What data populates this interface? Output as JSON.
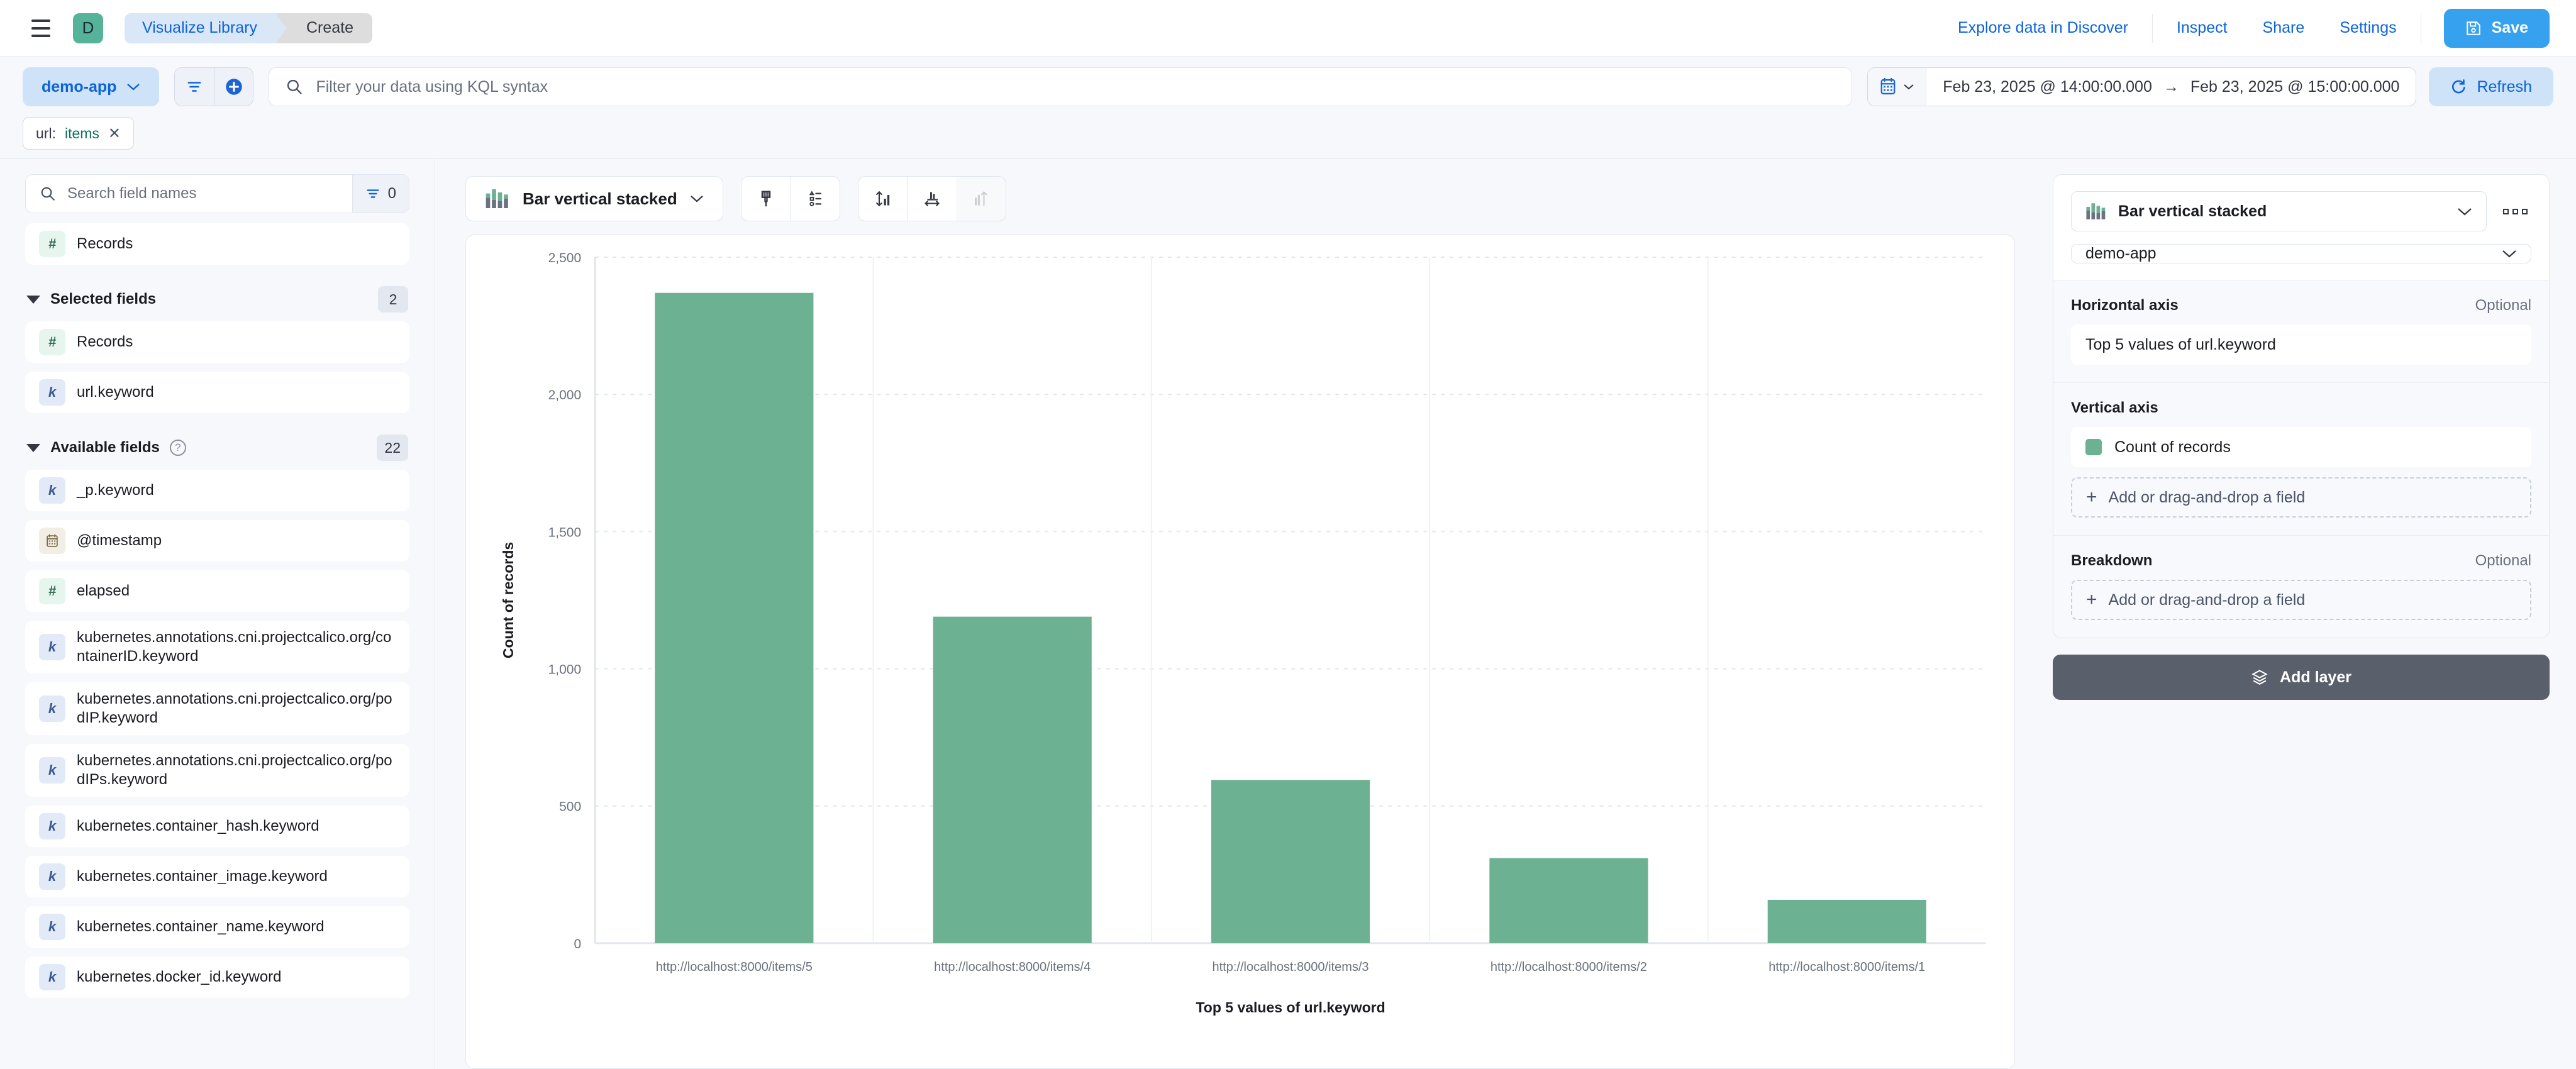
{
  "topnav": {
    "menu_icon": "hamburger-icon",
    "space_initial": "D",
    "breadcrumbs": [
      {
        "label": "Visualize Library"
      },
      {
        "label": "Create"
      }
    ],
    "links": [
      {
        "label": "Explore data in Discover"
      },
      {
        "label": "Inspect"
      },
      {
        "label": "Share"
      },
      {
        "label": "Settings"
      }
    ],
    "save_label": "Save",
    "save_icon": "save-disk-icon",
    "accent_blue": "#36A2EF"
  },
  "querybar": {
    "dataview": "demo-app",
    "filter_icon": "filter-lines-icon",
    "add_filter_icon": "plus-circle-icon",
    "search_icon": "search-icon",
    "kql_placeholder": "Filter your data using KQL syntax",
    "kql_value": "",
    "calendar_icon": "calendar-icon",
    "date_start": "Feb 23, 2025 @ 14:00:00.000",
    "date_arrow": "→",
    "date_end": "Feb 23, 2025 @ 15:00:00.000",
    "refresh_label": "Refresh",
    "refresh_icon": "refresh-icon"
  },
  "filters": [
    {
      "key": "url:",
      "value": "items",
      "remove_icon": "close-icon"
    }
  ],
  "sidebar": {
    "search_placeholder": "Search field names",
    "search_value": "",
    "field_filter_count": "0",
    "records_field": {
      "label": "Records",
      "type": "number",
      "badge": "#"
    },
    "selected_section": {
      "title": "Selected fields",
      "count": "2"
    },
    "selected_fields": [
      {
        "label": "Records",
        "type": "number",
        "badge": "#"
      },
      {
        "label": "url.keyword",
        "type": "string",
        "badge": "k"
      }
    ],
    "available_section": {
      "title": "Available fields",
      "count": "22",
      "help_icon": "question-icon"
    },
    "available_fields": [
      {
        "label": "_p.keyword",
        "type": "string",
        "badge": "k"
      },
      {
        "label": "@timestamp",
        "type": "date",
        "badge": "🗓"
      },
      {
        "label": "elapsed",
        "type": "number",
        "badge": "#"
      },
      {
        "label": "kubernetes.annotations.cni.projectcalico.org/containerID.keyword",
        "type": "string",
        "badge": "k"
      },
      {
        "label": "kubernetes.annotations.cni.projectcalico.org/podIP.keyword",
        "type": "string",
        "badge": "k"
      },
      {
        "label": "kubernetes.annotations.cni.projectcalico.org/podIPs.keyword",
        "type": "string",
        "badge": "k"
      },
      {
        "label": "kubernetes.container_hash.keyword",
        "type": "string",
        "badge": "k"
      },
      {
        "label": "kubernetes.container_image.keyword",
        "type": "string",
        "badge": "k"
      },
      {
        "label": "kubernetes.container_name.keyword",
        "type": "string",
        "badge": "k"
      },
      {
        "label": "kubernetes.docker_id.keyword",
        "type": "string",
        "badge": "k"
      }
    ]
  },
  "chart_toolbar": {
    "chart_type": "Bar vertical stacked",
    "chart_type_icon": "bar-chart-icon",
    "appearance_icon": "brush-icon",
    "legend_icon": "legend-list-icon",
    "vertical_axis_icon": "vertical-axis-icon",
    "horizontal_axis_icon": "horizontal-axis-icon",
    "secondary_axis_icon": "secondary-axis-icon"
  },
  "config": {
    "chart_type": "Bar vertical stacked",
    "chart_type_icon": "bar-chart-icon",
    "dataview": "demo-app",
    "more_icon": "more-options-icon",
    "horizontal": {
      "title": "Horizontal axis",
      "optional": "Optional",
      "dimension": "Top 5 values of url.keyword"
    },
    "vertical": {
      "title": "Vertical axis",
      "optional": "",
      "dimension": "Count of records",
      "swatch_color": "#6DB193",
      "add_field": "Add or drag-and-drop a field"
    },
    "breakdown": {
      "title": "Breakdown",
      "optional": "Optional",
      "add_field": "Add or drag-and-drop a field"
    },
    "add_layer": "Add layer",
    "add_layer_icon": "layers-icon"
  },
  "chart_data": {
    "type": "bar",
    "title": "",
    "xlabel": "Top 5 values of url.keyword",
    "ylabel": "Count of records",
    "categories": [
      "http://localhost:8000/items/5",
      "http://localhost:8000/items/4",
      "http://localhost:8000/items/3",
      "http://localhost:8000/items/2",
      "http://localhost:8000/items/1"
    ],
    "values": [
      2370,
      1190,
      595,
      310,
      158
    ],
    "series": [
      {
        "name": "Count of records",
        "color": "#6DB193",
        "values": [
          2370,
          1190,
          595,
          310,
          158
        ]
      }
    ],
    "ylim": [
      0,
      2500
    ],
    "yticks": [
      0,
      500,
      1000,
      1500,
      2000,
      2500
    ],
    "ytick_labels": [
      "0",
      "500",
      "1,000",
      "1,500",
      "2,000",
      "2,500"
    ],
    "grid": true,
    "legend": "none",
    "legend_position": "hidden"
  }
}
